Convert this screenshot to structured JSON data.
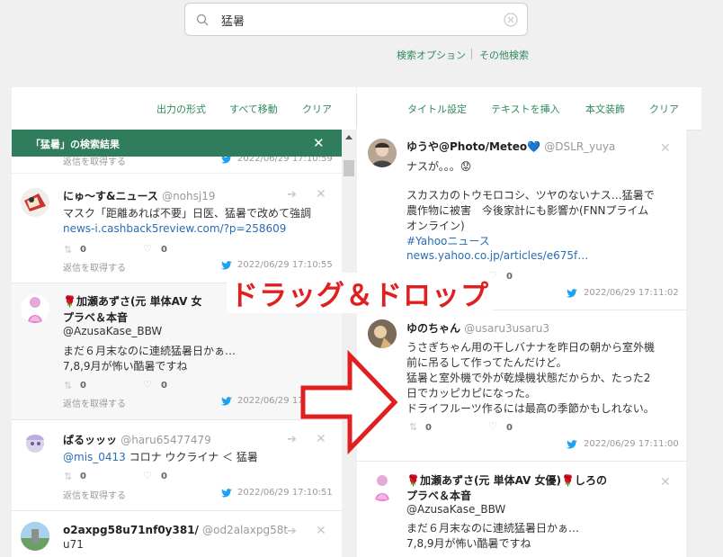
{
  "search": {
    "value": "猛暑"
  },
  "options": {
    "search_options": "検索オプション",
    "other_search": "その他検索"
  },
  "left_toolbar": {
    "output_format": "出力の形式",
    "move_all": "すべて移動",
    "clear": "クリア"
  },
  "right_toolbar": {
    "title_setting": "タイトル設定",
    "insert_text": "テキストを挿入",
    "decorate": "本文装飾",
    "clear": "クリア"
  },
  "results": {
    "header": "「猛暑」の検索結果",
    "close": "✕"
  },
  "overlay": {
    "label": "ドラッグ＆ドロップ"
  },
  "colors": {
    "accent": "#2f8a5e",
    "header_bg": "#2f7d5c",
    "overlay_red": "#e02020",
    "link": "#2a6db5"
  },
  "left_tweets": [
    {
      "reply_label": "返信を取得する",
      "date": "2022/06/29 17:10:59"
    },
    {
      "name": "にゅ〜す&ニュース",
      "handle": "@nohsj19",
      "lines": [
        "マスク「距離あれば不要」日医、猛暑で改めて強調"
      ],
      "link": "news-i.cashback5review.com/?p=258609",
      "rt": "0",
      "like": "0",
      "reply_label": "返信を取得する",
      "date": "2022/06/29 17:10:55"
    },
    {
      "name": "🌹加瀬あずさ(元 単体AV 女",
      "name2": "プラベ＆本音",
      "handle": "@AzusaKase_BBW",
      "lines": [
        "まだ６月末なのに連続猛暑日かぁ…",
        "7,8,9月が怖い酷暑ですね"
      ],
      "rt": "0",
      "like": "0",
      "reply_label": "返信を取得する",
      "date": "2022/06/29 17:10:53"
    },
    {
      "name": "ぱるッッッ",
      "handle": "@haru65477479",
      "mention": "@mis_0413",
      "text": " コロナ ウクライナ ＜ 猛暑",
      "rt": "0",
      "like": "0",
      "reply_label": "返信を取得する",
      "date": "2022/06/29 17:10:51"
    },
    {
      "name": "o2axpg58u71nf0y381/",
      "handle": "@od2alaxpg58t",
      "handle2": "u71"
    }
  ],
  "right_tweets": [
    {
      "name": "ゆうや@Photo/Meteo💙",
      "handle": "@DSLR_yuya",
      "lines": [
        "ナスが。。。😟",
        "",
        "スカスカのトウモロコシ、ツヤのないナス…猛暑で",
        "農作物に被害　今後家計にも影響か(FNNプライム",
        "オンライン)"
      ],
      "hashtag": "#Yahooニュース",
      "link": "news.yahoo.co.jp/articles/e675f…",
      "like": "0",
      "date": "2022/06/29 17:11:02"
    },
    {
      "name": "ゆのちゃん",
      "handle": "@usaru3usaru3",
      "lines": [
        "うさぎちゃん用の干しバナナを昨日の朝から室外機",
        "前に吊るして作ってたんだけど。",
        "猛暑と室外機で外が乾燥機状態だからか、たった2",
        "日でカッピカピになった。",
        "ドライフルーツ作るには最高の季節かもしれない。"
      ],
      "rt": "0",
      "like": "0",
      "date": "2022/06/29 17:11:00"
    },
    {
      "name": "🌹加瀬あずさ(元 単体AV 女優)🌹しろの",
      "name2": "プラベ＆本音",
      "handle": "@AzusaKase_BBW",
      "lines": [
        "まだ６月末なのに連続猛暑日かぁ…",
        "7,8,9月が怖い酷暑ですね"
      ]
    }
  ]
}
